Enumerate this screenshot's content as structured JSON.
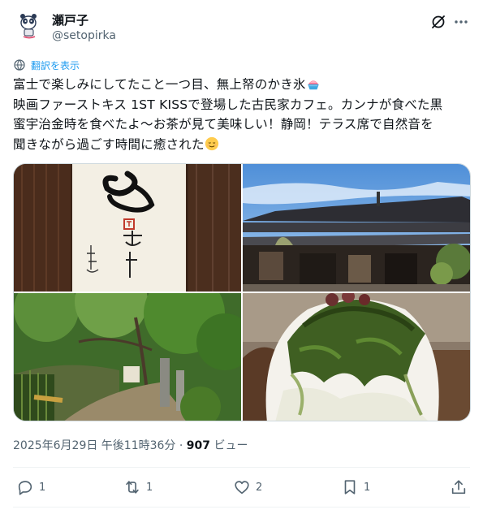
{
  "author": {
    "display_name": "瀬戸子",
    "handle": "@setopirka"
  },
  "translate": {
    "label": "翻訳を表示"
  },
  "tweet": {
    "line1": "富士で楽しみにしてたこと一つ目、無上帑のかき氷",
    "line2": "映画ファーストキス 1ST KISSで登場した古民家カフェ。カンナが食べた黒",
    "line3": "蜜宇治金時を食べたよ〜お茶が見て美味しい！静岡！テラス席で自然音を",
    "line4": "聞きながら過ごす時間に癒された"
  },
  "emojis": [
    "shaved-ice-icon",
    "relieved-face-icon"
  ],
  "media": {
    "photos": [
      {
        "name": "calligraphy-sign-photo"
      },
      {
        "name": "kominka-building-photo"
      },
      {
        "name": "garden-path-photo"
      },
      {
        "name": "matcha-kakigori-photo"
      }
    ]
  },
  "meta": {
    "datetime": "2025年6月29日 午後11時36分",
    "separator": " · ",
    "views_count": "907",
    "views_label": " ビュー"
  },
  "actions": {
    "reply_count": "1",
    "retweet_count": "1",
    "like_count": "2",
    "bookmark_count": "1"
  },
  "colors": {
    "accent": "#1d9bf0",
    "secondary_text": "#536471",
    "primary_text": "#0f1419",
    "border": "#cfd9de"
  }
}
